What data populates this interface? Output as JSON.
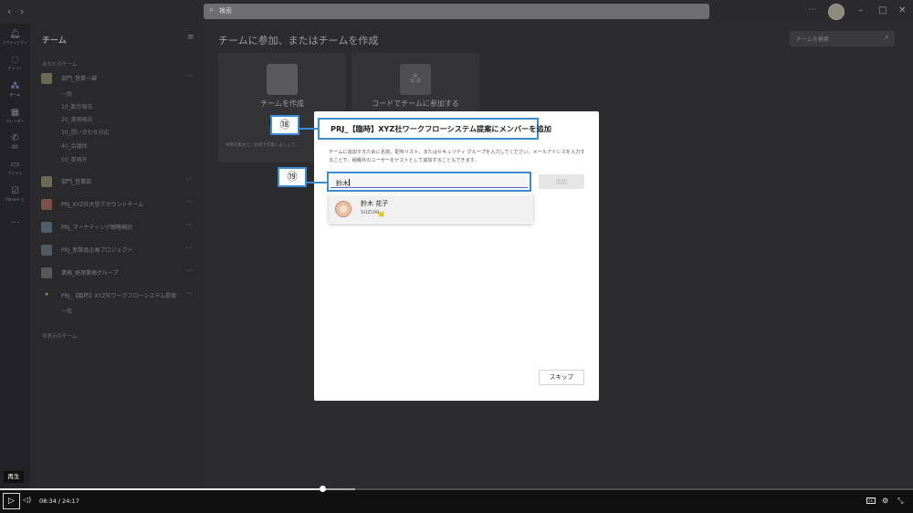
{
  "titlebar": {
    "search_placeholder": "検索"
  },
  "rail": [
    {
      "label": "アクティビティ",
      "icon": "bell-icon"
    },
    {
      "label": "チャット",
      "icon": "chat-icon"
    },
    {
      "label": "チーム",
      "icon": "teams-icon"
    },
    {
      "label": "カレンダー",
      "icon": "calendar-icon"
    },
    {
      "label": "通話",
      "icon": "phone-icon"
    },
    {
      "label": "ファイル",
      "icon": "file-icon"
    },
    {
      "label": "Planner と",
      "icon": "planner-icon"
    },
    {
      "label": "...",
      "icon": "more-icon"
    }
  ],
  "panel": {
    "title": "チーム",
    "your_teams_label": "あなたのチーム",
    "hidden_teams_label": "非表示のチーム",
    "teams": [
      {
        "name": "部門_営業一課",
        "channels": [
          "一般",
          "10_勤怠報告",
          "20_業務報告",
          "30_問い合わせ対応",
          "40_会議体",
          "50_業務外"
        ]
      },
      {
        "name": "部門_営業部",
        "channels": []
      },
      {
        "name": "PRJ_XYZ社大型アカウントチーム",
        "channels": []
      },
      {
        "name": "PRJ_マーケティング戦略検討",
        "channels": []
      },
      {
        "name": "PRJ_新製品企画プロジェクト",
        "channels": []
      },
      {
        "name": "業務_経理業務グループ",
        "channels": []
      },
      {
        "name": "PRJ_【臨時】XYZ社ワークフローシステム提案",
        "channels": [
          "一般"
        ]
      }
    ]
  },
  "main": {
    "title": "チームに参加、またはチームを作成",
    "team_search_placeholder": "チームを検索",
    "create_card": {
      "label": "チームを作成",
      "desc": "仲間を集めて、共同で作業しましょう。"
    },
    "join_card": {
      "label": "コードでチームに参加する"
    }
  },
  "dialog": {
    "title": "PRJ_【臨時】XYZ社ワークフローシステム提案にメンバーを追加",
    "description": "チームに追加するために名前、配布リスト、またはセキュリティ グループを入力してください。メールアドレスを入力することで、組織外のユーザーをゲストとして追加することもできます。",
    "input_value": "鈴木",
    "add_label": "追加",
    "skip_label": "スキップ",
    "suggestion": {
      "name": "鈴木 花子",
      "id": "SUZUKI"
    }
  },
  "callouts": {
    "title": "⑱",
    "input": "⑲"
  },
  "player": {
    "tooltip": "再生",
    "current": "08:34",
    "separator": "/",
    "total": "24:17",
    "progress": 0.353,
    "buffered": 0.389
  }
}
